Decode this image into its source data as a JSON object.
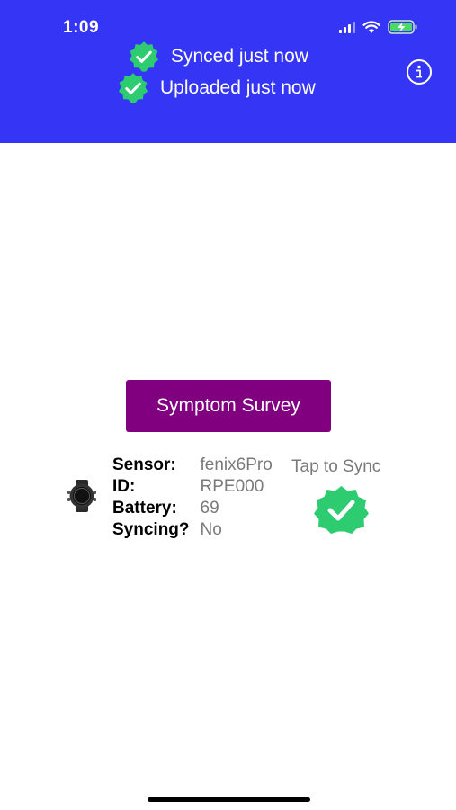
{
  "status_bar": {
    "time": "1:09"
  },
  "header": {
    "synced_text": "Synced just now",
    "uploaded_text": "Uploaded just now",
    "info_icon": "info-icon",
    "background_color": "#3535f5",
    "badge_color": "#2ecc71"
  },
  "main": {
    "survey_button_label": "Symptom Survey",
    "survey_button_color": "#800080"
  },
  "device": {
    "icon": "watch-icon",
    "sensor_label": "Sensor:",
    "sensor_value": "fenix6Pro",
    "id_label": "ID:",
    "id_value": "RPE000",
    "battery_label": "Battery:",
    "battery_value": "69",
    "syncing_label": "Syncing?",
    "syncing_value": "No",
    "tap_to_sync": "Tap to Sync",
    "sync_status_icon": "check-badge-icon"
  }
}
